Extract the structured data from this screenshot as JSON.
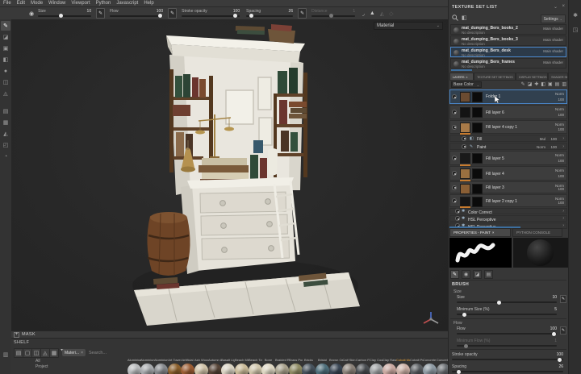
{
  "menu": {
    "items": [
      "File",
      "Edit",
      "Mode",
      "Window",
      "Viewport",
      "Python",
      "Javascript",
      "Help"
    ]
  },
  "toolbar": {
    "size_label": "Size",
    "size_value": "10",
    "flow_label": "Flow",
    "flow_value": "100",
    "opacity_label": "Stroke opacity",
    "opacity_value": "100",
    "spacing_label": "Spacing",
    "spacing_value": "26",
    "distance_label": "Distance",
    "distance_value": "1"
  },
  "viewport": {
    "shading_mode": "Material"
  },
  "texture_set_list": {
    "title": "TEXTURE SET LIST",
    "settings_label": "Settings",
    "sets": [
      {
        "name": "mat_dumping_Bers_books_2",
        "description": "No description",
        "shader": "Main shader"
      },
      {
        "name": "mat_dumping_Bers_books_3",
        "description": "No description",
        "shader": "Main shader"
      },
      {
        "name": "mat_dumping_Bers_desk",
        "description": "No description",
        "shader": "Main shader"
      },
      {
        "name": "mat_dumping_Bers_frames",
        "description": "No description",
        "shader": "Main shader"
      }
    ]
  },
  "layers_panel": {
    "tabs": [
      "LAYERS",
      "TEXTURE SET SETTINGS",
      "DISPLAY SETTINGS",
      "SHADER SETTINGS"
    ],
    "channel": "Base Color",
    "layers": [
      {
        "name": "Folder 1",
        "blend": "Norm",
        "opacity": "100"
      },
      {
        "name": "Fill layer 6",
        "blend": "Norm",
        "opacity": "100"
      },
      {
        "name": "Fill layer 4 copy 1",
        "blend": "Norm",
        "opacity": "100"
      },
      {
        "name": "Fill",
        "blend": "Mul",
        "opacity": "100"
      },
      {
        "name": "Paint",
        "blend": "Norm",
        "opacity": "100"
      },
      {
        "name": "Fill layer 5",
        "blend": "Norm",
        "opacity": "100"
      },
      {
        "name": "Fill layer 4",
        "blend": "Norm",
        "opacity": "100"
      },
      {
        "name": "Fill layer 3",
        "blend": "Norm",
        "opacity": "100"
      },
      {
        "name": "Fill layer 2 copy 1",
        "blend": "Norm",
        "opacity": "100"
      },
      {
        "name": "Color Correct"
      },
      {
        "name": "HSL Perceptive"
      },
      {
        "name": "HSL Perceptive"
      }
    ]
  },
  "properties": {
    "tab_paint": "PROPERTIES - PAINT",
    "tab_console": "PYTHON CONSOLE",
    "section": "BRUSH",
    "size_group": "Size",
    "flow_group": "Flow",
    "size": {
      "label": "Size",
      "value": "10"
    },
    "min_size": {
      "label": "Minimum Size (%)",
      "value": "5"
    },
    "flow": {
      "label": "Flow",
      "value": "100"
    },
    "min_flow": {
      "label": "Minimum Flow (%)",
      "value": "1"
    },
    "stroke_opacity": {
      "label": "Stroke opacity",
      "value": "100"
    },
    "spacing": {
      "label": "Spacing",
      "value": "26"
    }
  },
  "mask_bar": {
    "label": "MASK"
  },
  "shelf": {
    "title": "SHELF",
    "filter_chip": "Materi...",
    "search_placeholder": "Search...",
    "categories": [
      "All",
      "Project"
    ],
    "materials": [
      {
        "label": "Aluminium",
        "color": "#b7b9bb"
      },
      {
        "label": "Aluminium",
        "color": "#a6a9ac"
      },
      {
        "label": "Aluminium",
        "color": "#85888c"
      },
      {
        "label": "Art Towel",
        "color": "#8a5f2c"
      },
      {
        "label": "Artificial",
        "color": "#9a5c33"
      },
      {
        "label": "Ash Wood",
        "color": "#cfc2a8"
      },
      {
        "label": "Autumn Leaf",
        "color": "#564437"
      },
      {
        "label": "Basalt Light",
        "color": "#d8d2c2"
      },
      {
        "label": "Beach Mix",
        "color": "#c9ba98"
      },
      {
        "label": "Beach Towel",
        "color": "#cfc5ab"
      },
      {
        "label": "Bone",
        "color": "#ddd6c2"
      },
      {
        "label": "Braided Ro",
        "color": "#a8a18c"
      },
      {
        "label": "Brass Pure",
        "color": "#8e8a63"
      },
      {
        "label": "Bricks",
        "color": "#46525c"
      },
      {
        "label": "Bristol",
        "color": "#4e6e7a"
      },
      {
        "label": "Brown Oak",
        "color": "#3a4654"
      },
      {
        "label": "Calf Skin",
        "color": "#8a8178"
      },
      {
        "label": "Carbon Fib",
        "color": "#4a4e52"
      },
      {
        "label": "Clay Court",
        "color": "#9fa2a4"
      },
      {
        "label": "Clay Raw",
        "color": "#c9a8a0"
      },
      {
        "label": "Cobalt Metal",
        "color": "#cbb0a6"
      },
      {
        "label": "Cobalt Pure",
        "color": "#5a5e62"
      },
      {
        "label": "Concrete A",
        "color": "#8d99a2"
      },
      {
        "label": "Concrete D",
        "color": "#6a6e72"
      }
    ]
  }
}
